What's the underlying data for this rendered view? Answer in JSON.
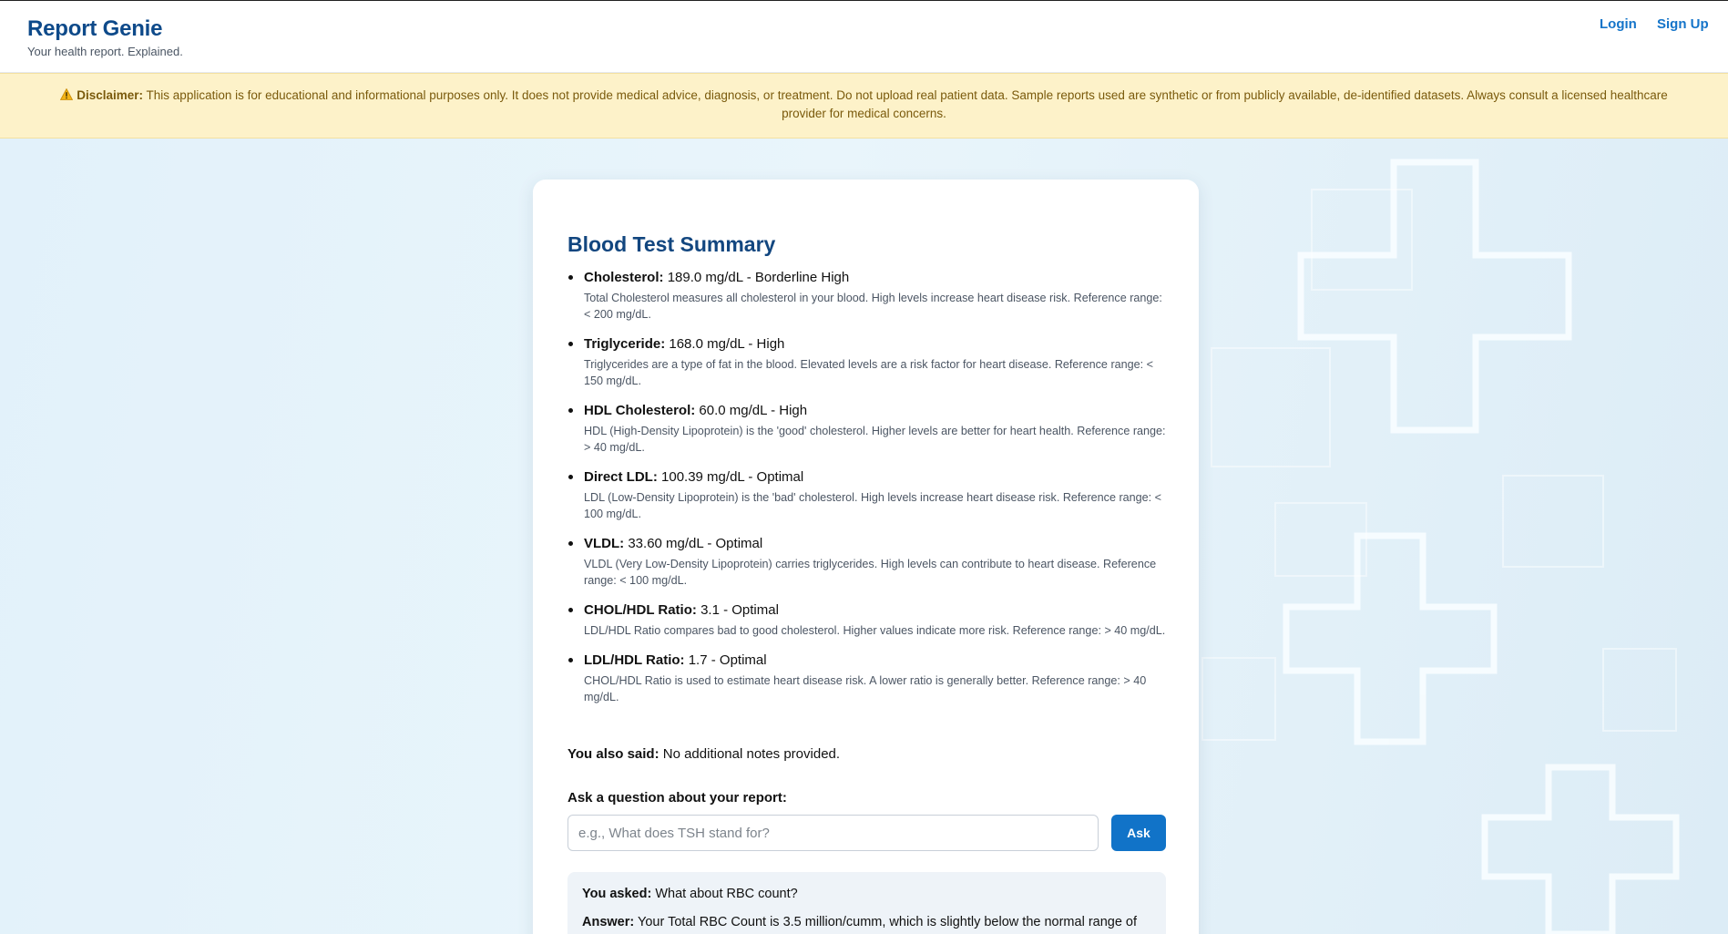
{
  "header": {
    "title": "Report Genie",
    "tagline": "Your health report. Explained.",
    "login": "Login",
    "signup": "Sign Up"
  },
  "disclaimer": {
    "icon": "warning-icon",
    "label": "Disclaimer:",
    "text": "This application is for educational and informational purposes only. It does not provide medical advice, diagnosis, or treatment. Do not upload real patient data. Sample reports used are synthetic or from publicly available, de-identified datasets. Always consult a licensed healthcare provider for medical concerns."
  },
  "summary": {
    "title": "Blood Test Summary",
    "results": [
      {
        "name": "Cholesterol:",
        "value": "189.0 mg/dL - Borderline High",
        "description": "Total Cholesterol measures all cholesterol in your blood. High levels increase heart disease risk. Reference range: < 200 mg/dL."
      },
      {
        "name": "Triglyceride:",
        "value": "168.0 mg/dL - High",
        "description": "Triglycerides are a type of fat in the blood. Elevated levels are a risk factor for heart disease. Reference range: < 150 mg/dL."
      },
      {
        "name": "HDL Cholesterol:",
        "value": "60.0 mg/dL - High",
        "description": "HDL (High-Density Lipoprotein) is the 'good' cholesterol. Higher levels are better for heart health. Reference range: > 40 mg/dL."
      },
      {
        "name": "Direct LDL:",
        "value": "100.39 mg/dL - Optimal",
        "description": "LDL (Low-Density Lipoprotein) is the 'bad' cholesterol. High levels increase heart disease risk. Reference range: < 100 mg/dL."
      },
      {
        "name": "VLDL:",
        "value": "33.60 mg/dL - Optimal",
        "description": "VLDL (Very Low-Density Lipoprotein) carries triglycerides. High levels can contribute to heart disease. Reference range: < 100 mg/dL."
      },
      {
        "name": "CHOL/HDL Ratio:",
        "value": "3.1 - Optimal",
        "description": "LDL/HDL Ratio compares bad to good cholesterol. Higher values indicate more risk. Reference range: > 40 mg/dL."
      },
      {
        "name": "LDL/HDL Ratio:",
        "value": "1.7 - Optimal",
        "description": "CHOL/HDL Ratio is used to estimate heart disease risk. A lower ratio is generally better. Reference range: > 40 mg/dL."
      }
    ],
    "notes_label": "You also said:",
    "notes_text": "No additional notes provided."
  },
  "ask": {
    "label": "Ask a question about your report:",
    "placeholder": "e.g., What does TSH stand for?",
    "value": "",
    "button": "Ask"
  },
  "qa": {
    "question_label": "You asked:",
    "question": "What about RBC count?",
    "answer_label": "Answer:",
    "answer": "Your Total RBC Count is 3.5 million/cumm, which is slightly below the normal range of"
  },
  "colors": {
    "brand": "#0e4a8a",
    "link": "#1474c9",
    "button": "#1173c8",
    "disclaimer_bg": "#fdf2c9",
    "disclaimer_text": "#7a5a0c"
  }
}
